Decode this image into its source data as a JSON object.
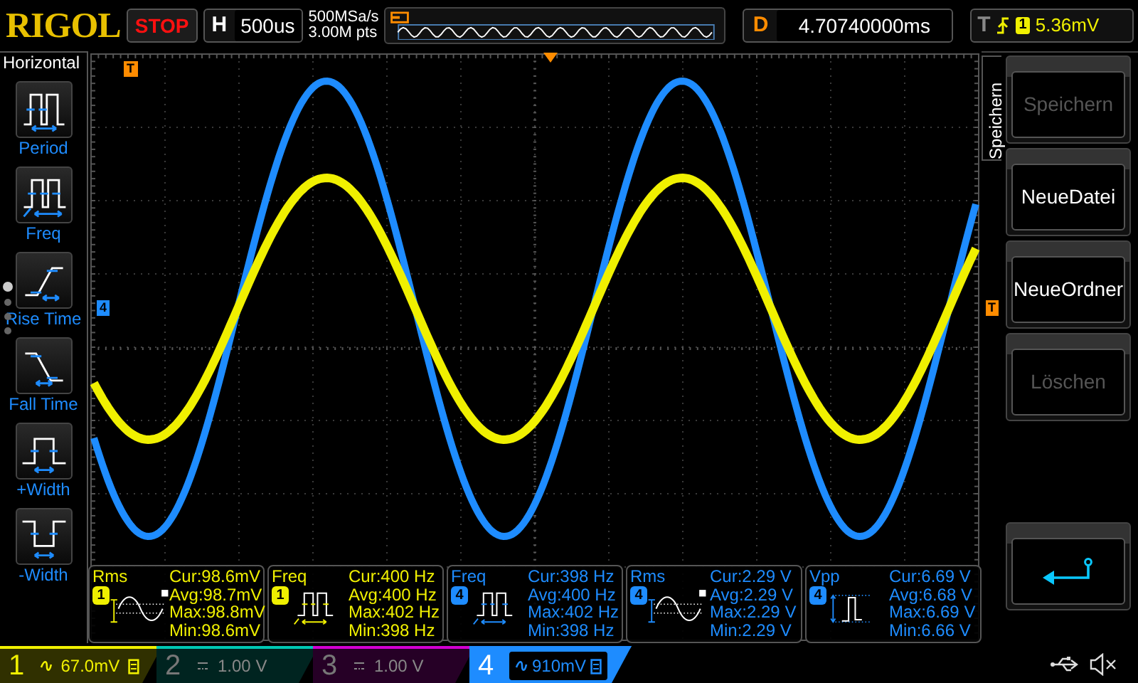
{
  "top_bar": {
    "brand": "RIGOL",
    "run_state": "STOP",
    "horizontal": {
      "label": "H",
      "timebase": "500us"
    },
    "sample_rate": "500MSa/s",
    "memory_depth": "3.00M pts",
    "delay": {
      "label": "D",
      "value": "4.70740000ms"
    },
    "trigger": {
      "label": "T",
      "channel": "1",
      "level": "5.36mV"
    }
  },
  "left_menu": {
    "title": "Horizontal",
    "pages": [
      {
        "selected": true
      },
      {
        "selected": false
      },
      {
        "selected": false
      },
      {
        "selected": false
      }
    ],
    "items": [
      {
        "kind": "period",
        "label": "Period"
      },
      {
        "kind": "freq",
        "label": "Freq"
      },
      {
        "kind": "rise",
        "label": "Rise Time"
      },
      {
        "kind": "fall",
        "label": "Fall Time"
      },
      {
        "kind": "pwidth",
        "label": "+Width"
      },
      {
        "kind": "nwidth",
        "label": "-Width"
      }
    ]
  },
  "grid": {
    "trigger_position_marker": "T",
    "channel_marker": "4",
    "trigger_level_marker": "T"
  },
  "measurements": [
    {
      "kind": "rms",
      "name": "Rms",
      "channel": "1",
      "color": "#f0f000",
      "cur": "Cur:98.6mV",
      "avg": "Avg:98.7mV",
      "max": "Max:98.8mV",
      "min": "Min:98.6mV"
    },
    {
      "kind": "freq",
      "name": "Freq",
      "channel": "1",
      "color": "#f0f000",
      "cur": "Cur:400 Hz",
      "avg": "Avg:400 Hz",
      "max": "Max:402 Hz",
      "min": "Min:398 Hz"
    },
    {
      "kind": "freq",
      "name": "Freq",
      "channel": "4",
      "color": "#1e8cff",
      "cur": "Cur:398 Hz",
      "avg": "Avg:400 Hz",
      "max": "Max:402 Hz",
      "min": "Min:398 Hz"
    },
    {
      "kind": "rms",
      "name": "Rms",
      "channel": "4",
      "color": "#1e8cff",
      "cur": "Cur:2.29 V",
      "avg": "Avg:2.29 V",
      "max": "Max:2.29 V",
      "min": "Min:2.29 V"
    },
    {
      "kind": "vpp",
      "name": "Vpp",
      "channel": "4",
      "color": "#1e8cff",
      "cur": "Cur:6.69 V",
      "avg": "Avg:6.68 V",
      "max": "Max:6.69 V",
      "min": "Min:6.66 V"
    }
  ],
  "softkeys": {
    "title": "Speichern",
    "buttons": [
      {
        "label": "Speichern",
        "disabled": true
      },
      {
        "label": "NeueDatei",
        "disabled": false
      },
      {
        "label": "NeueOrdner",
        "disabled": false
      },
      {
        "label": "Löschen",
        "disabled": true
      }
    ]
  },
  "channels": [
    {
      "number": "1",
      "kind": "ac",
      "scale": "67.0mV",
      "on": true,
      "selected": false,
      "color": "#f0f000"
    },
    {
      "number": "2",
      "kind": "dc",
      "scale": "1.00 V",
      "on": false,
      "selected": false,
      "color": "#00c8b4"
    },
    {
      "number": "3",
      "kind": "dc",
      "scale": "1.00 V",
      "on": false,
      "selected": false,
      "color": "#d200d2"
    },
    {
      "number": "4",
      "kind": "ac",
      "scale": "910mV",
      "on": true,
      "selected": true,
      "color": "#1e8cff"
    }
  ]
}
